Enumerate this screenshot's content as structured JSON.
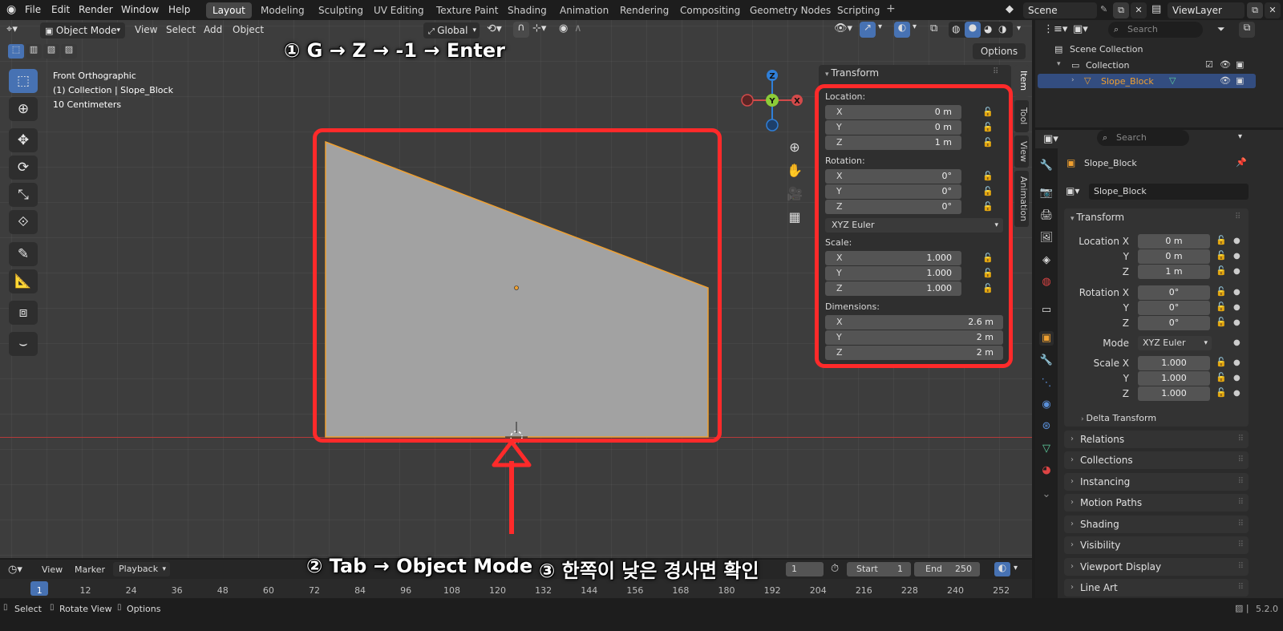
{
  "menubar": {
    "items": [
      "File",
      "Edit",
      "Render",
      "Window",
      "Help"
    ]
  },
  "workspaces": [
    "Layout",
    "Modeling",
    "Sculpting",
    "UV Editing",
    "Texture Paint",
    "Shading",
    "Animation",
    "Rendering",
    "Compositing",
    "Geometry Nodes",
    "Scripting"
  ],
  "scene": {
    "label": "Scene",
    "view_layer": "ViewLayer"
  },
  "viewport_header": {
    "mode": "Object Mode",
    "menus": [
      "View",
      "Select",
      "Add",
      "Object"
    ],
    "orientation": "Global",
    "options": "Options"
  },
  "viewport_info": {
    "line1": "Front Orthographic",
    "line2": "(1) Collection | Slope_Block",
    "line3": "10 Centimeters"
  },
  "gizmo": {
    "z": "Z",
    "y": "Y",
    "x": "X"
  },
  "npanel": {
    "title": "Transform",
    "location_label": "Location:",
    "location": [
      {
        "axis": "X",
        "value": "0 m"
      },
      {
        "axis": "Y",
        "value": "0 m"
      },
      {
        "axis": "Z",
        "value": "1 m"
      }
    ],
    "rotation_label": "Rotation:",
    "rotation": [
      {
        "axis": "X",
        "value": "0°"
      },
      {
        "axis": "Y",
        "value": "0°"
      },
      {
        "axis": "Z",
        "value": "0°"
      }
    ],
    "rotation_mode": "XYZ Euler",
    "scale_label": "Scale:",
    "scale": [
      {
        "axis": "X",
        "value": "1.000"
      },
      {
        "axis": "Y",
        "value": "1.000"
      },
      {
        "axis": "Z",
        "value": "1.000"
      }
    ],
    "dimensions_label": "Dimensions:",
    "dimensions": [
      {
        "axis": "X",
        "value": "2.6 m"
      },
      {
        "axis": "Y",
        "value": "2 m"
      },
      {
        "axis": "Z",
        "value": "2 m"
      }
    ],
    "tabs": [
      "Item",
      "Tool",
      "View",
      "Animation"
    ]
  },
  "annotations": {
    "top": "① G → Z → -1 → Enter",
    "bottom_left": "② Tab → Object Mode",
    "bottom_right": "③ 한쪽이 낮은 경사면 확인"
  },
  "timeline": {
    "menus": [
      "View",
      "Marker",
      "Playback"
    ],
    "current_frame": "1",
    "start_label": "Start",
    "start": "1",
    "end_label": "End",
    "end": "250",
    "ticks": [
      "1",
      "12",
      "24",
      "36",
      "48",
      "60",
      "72",
      "84",
      "96",
      "108",
      "120",
      "132",
      "144",
      "156",
      "168",
      "180",
      "192",
      "204",
      "216",
      "228",
      "240",
      "252"
    ]
  },
  "outliner": {
    "search_placeholder": "Search",
    "scene_collection": "Scene Collection",
    "collection": "Collection",
    "object": "Slope_Block"
  },
  "properties": {
    "search_placeholder": "Search",
    "object_name": "Slope_Block",
    "object_field": "Slope_Block",
    "section": "Transform",
    "location_x_label": "Location X",
    "loc": [
      "0 m",
      "0 m",
      "1 m"
    ],
    "rotation_x_label": "Rotation X",
    "rot": [
      "0°",
      "0°",
      "0°"
    ],
    "mode_label": "Mode",
    "mode": "XYZ Euler",
    "scale_x_label": "Scale X",
    "scl": [
      "1.000",
      "1.000",
      "1.000"
    ],
    "y_label": "Y",
    "z_label": "Z",
    "delta": "Delta Transform",
    "sections": [
      "Relations",
      "Collections",
      "Instancing",
      "Motion Paths",
      "Shading",
      "Visibility",
      "Viewport Display",
      "Line Art"
    ]
  },
  "statusbar": {
    "select": "Select",
    "rotate": "Rotate View",
    "options": "Options",
    "version": "5.2.0"
  },
  "colors": {
    "accent": "#4772b3",
    "annotation_red": "#ff2a2a",
    "selection_orange": "#f0a030",
    "mesh_gray": "#a2a2a2"
  }
}
